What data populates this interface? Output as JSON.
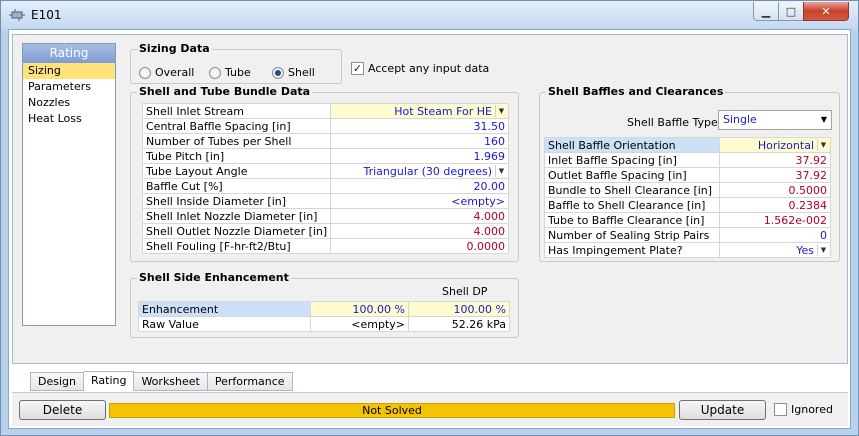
{
  "window": {
    "title": "E101"
  },
  "nav": {
    "header": "Rating",
    "items": [
      {
        "label": "Sizing",
        "selected": true
      },
      {
        "label": "Parameters",
        "selected": false
      },
      {
        "label": "Nozzles",
        "selected": false
      },
      {
        "label": "Heat Loss",
        "selected": false
      }
    ]
  },
  "sizing_data": {
    "title": "Sizing Data",
    "options": [
      "Overall",
      "Tube",
      "Shell"
    ],
    "selected": "Shell",
    "accept_label": "Accept any input data",
    "accept_checked": true
  },
  "bundle": {
    "title": "Shell and Tube Bundle Data",
    "rows": [
      {
        "label": "Shell Inlet Stream",
        "value": "Hot Steam For HE"
      },
      {
        "label": "Central Baffle Spacing [in]",
        "value": "31.50"
      },
      {
        "label": "Number of Tubes per Shell",
        "value": "160"
      },
      {
        "label": "Tube Pitch [in]",
        "value": "1.969"
      },
      {
        "label": "Tube Layout Angle",
        "value": "Triangular (30 degrees)"
      },
      {
        "label": "Baffle Cut [%]",
        "value": "20.00"
      },
      {
        "label": "Shell Inside Diameter [in]",
        "value": "<empty>"
      },
      {
        "label": "Shell Inlet Nozzle Diameter [in]",
        "value": "4.000"
      },
      {
        "label": "Shell Outlet Nozzle Diameter [in]",
        "value": "4.000"
      },
      {
        "label": "Shell Fouling [F-hr-ft2/Btu]",
        "value": "0.0000"
      }
    ]
  },
  "enhancement": {
    "title": "Shell Side Enhancement",
    "col_header": "Shell DP",
    "rows": [
      {
        "label": "Enhancement",
        "value1": "100.00 %",
        "value2": "100.00 %"
      },
      {
        "label": "Raw Value",
        "value1": "<empty>",
        "value2": "52.26 kPa"
      }
    ]
  },
  "baffles": {
    "title": "Shell Baffles and Clearances",
    "type_label": "Shell Baffle Type",
    "type_value": "Single",
    "rows": [
      {
        "label": "Shell Baffle Orientation",
        "value": "Horizontal"
      },
      {
        "label": "Inlet Baffle Spacing [in]",
        "value": "37.92"
      },
      {
        "label": "Outlet Baffle Spacing [in]",
        "value": "37.92"
      },
      {
        "label": "Bundle to Shell Clearance [in]",
        "value": "0.5000"
      },
      {
        "label": "Baffle to Shell Clearance [in]",
        "value": "0.2384"
      },
      {
        "label": "Tube to Baffle Clearance [in]",
        "value": "1.562e-002"
      },
      {
        "label": "Number of Sealing Strip Pairs",
        "value": "0"
      },
      {
        "label": "Has Impingement Plate?",
        "value": "Yes"
      }
    ]
  },
  "tabs": [
    "Design",
    "Rating",
    "Worksheet",
    "Performance"
  ],
  "active_tab": "Rating",
  "bottom": {
    "delete_label": "Delete",
    "status": "Not Solved",
    "update_label": "Update",
    "ignored_label": "Ignored",
    "ignored_checked": false
  },
  "colors": {
    "status": "#f5c400",
    "nav_selected": "#ffe37a",
    "value_blue": "#1a1acc",
    "value_red": "#b0002a"
  }
}
